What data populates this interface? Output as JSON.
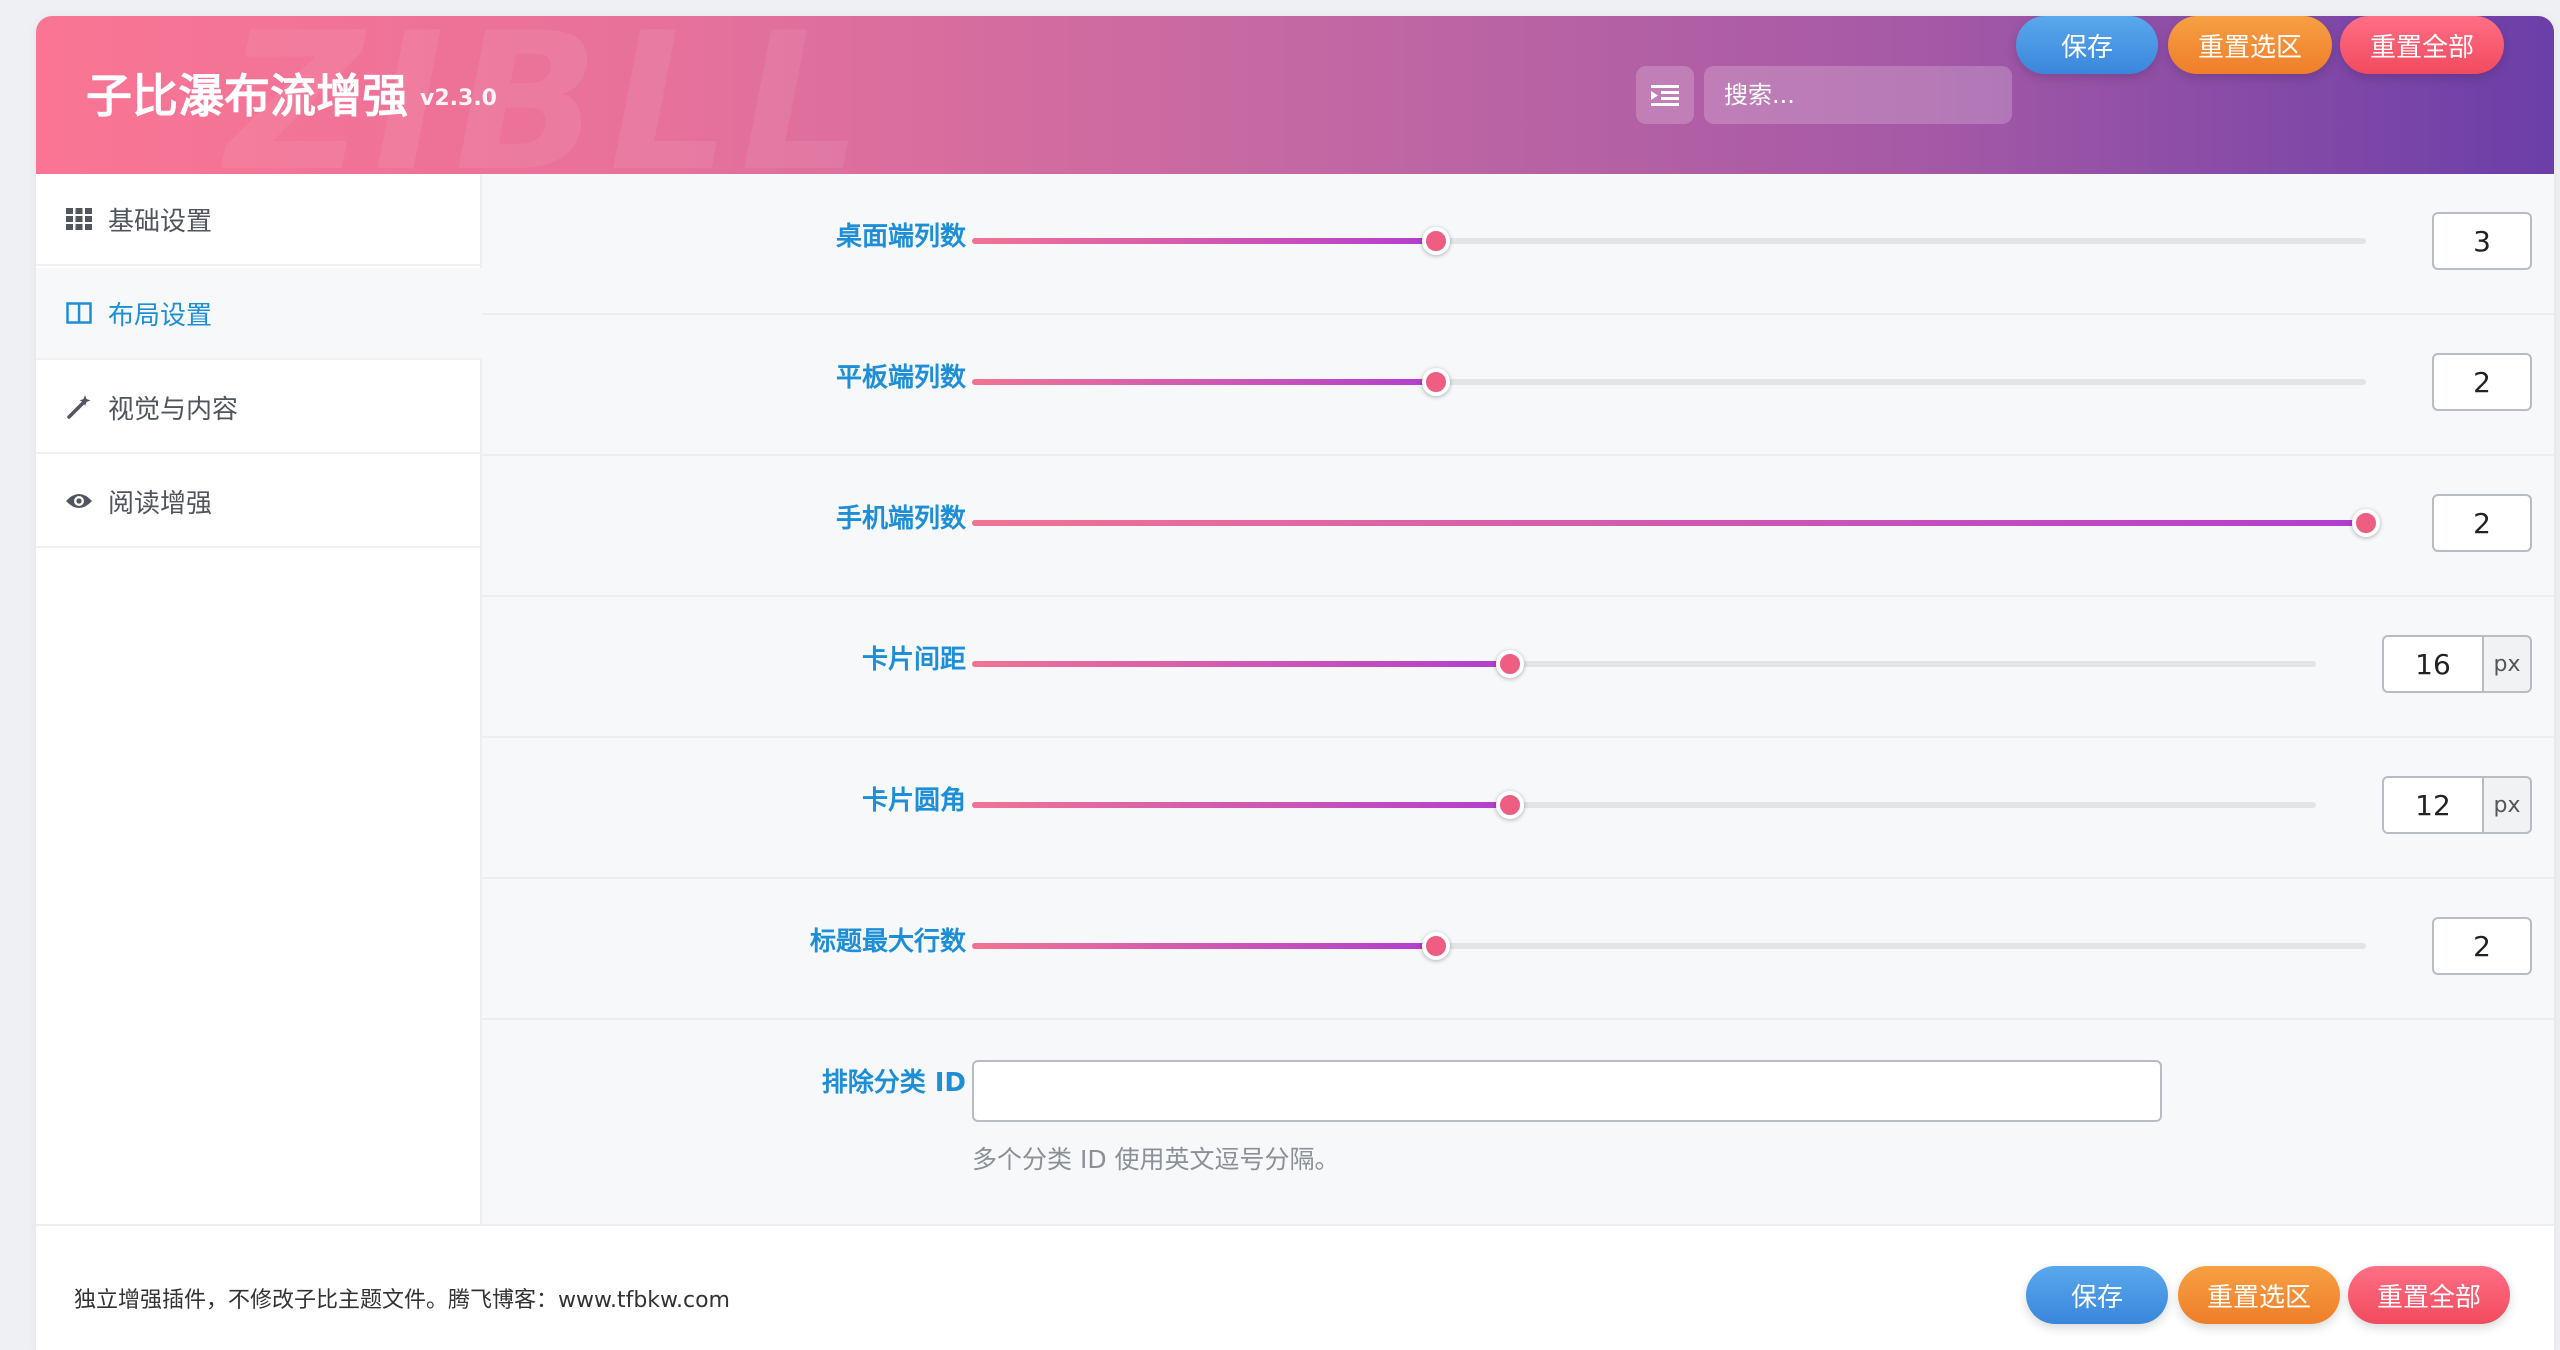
{
  "header": {
    "title": "子比瀑布流增强",
    "version": "v2.3.0",
    "watermark": "ZIBLL",
    "search_placeholder": "搜索...",
    "save_label": "保存",
    "reset_section_label": "重置选区",
    "reset_all_label": "重置全部"
  },
  "sidebar": {
    "items": [
      {
        "label": "基础设置",
        "icon": "grid-icon",
        "active": false
      },
      {
        "label": "布局设置",
        "icon": "columns-icon",
        "active": true
      },
      {
        "label": "视觉与内容",
        "icon": "magic-wand-icon",
        "active": false
      },
      {
        "label": "阅读增强",
        "icon": "eye-icon",
        "active": false
      }
    ]
  },
  "main": {
    "rows": [
      {
        "label": "桌面端列数",
        "value": "3",
        "fill_fraction": 0.333
      },
      {
        "label": "平板端列数",
        "value": "2",
        "fill_fraction": 0.333
      },
      {
        "label": "手机端列数",
        "value": "2",
        "fill_fraction": 1.0
      },
      {
        "label": "卡片间距",
        "value": "16",
        "unit": "px",
        "fill_fraction": 0.4
      },
      {
        "label": "卡片圆角",
        "value": "12",
        "unit": "px",
        "fill_fraction": 0.4
      },
      {
        "label": "标题最大行数",
        "value": "2",
        "fill_fraction": 0.333
      }
    ],
    "exclude": {
      "label": "排除分类 ID",
      "value": "",
      "help": "多个分类 ID 使用英文逗号分隔。"
    }
  },
  "footer": {
    "note": "独立增强插件，不修改子比主题文件。腾飞博客：www.tfbkw.com",
    "save_label": "保存",
    "reset_section_label": "重置选区",
    "reset_all_label": "重置全部"
  },
  "colors": {
    "accent": "#1e8fd6",
    "header_start": "#fa7593",
    "header_end": "#6b3ea8",
    "slider_thumb": "#ee5d82",
    "save": "#3a86dc",
    "reset_section": "#ef7e2a",
    "reset_all": "#f24a5e"
  }
}
